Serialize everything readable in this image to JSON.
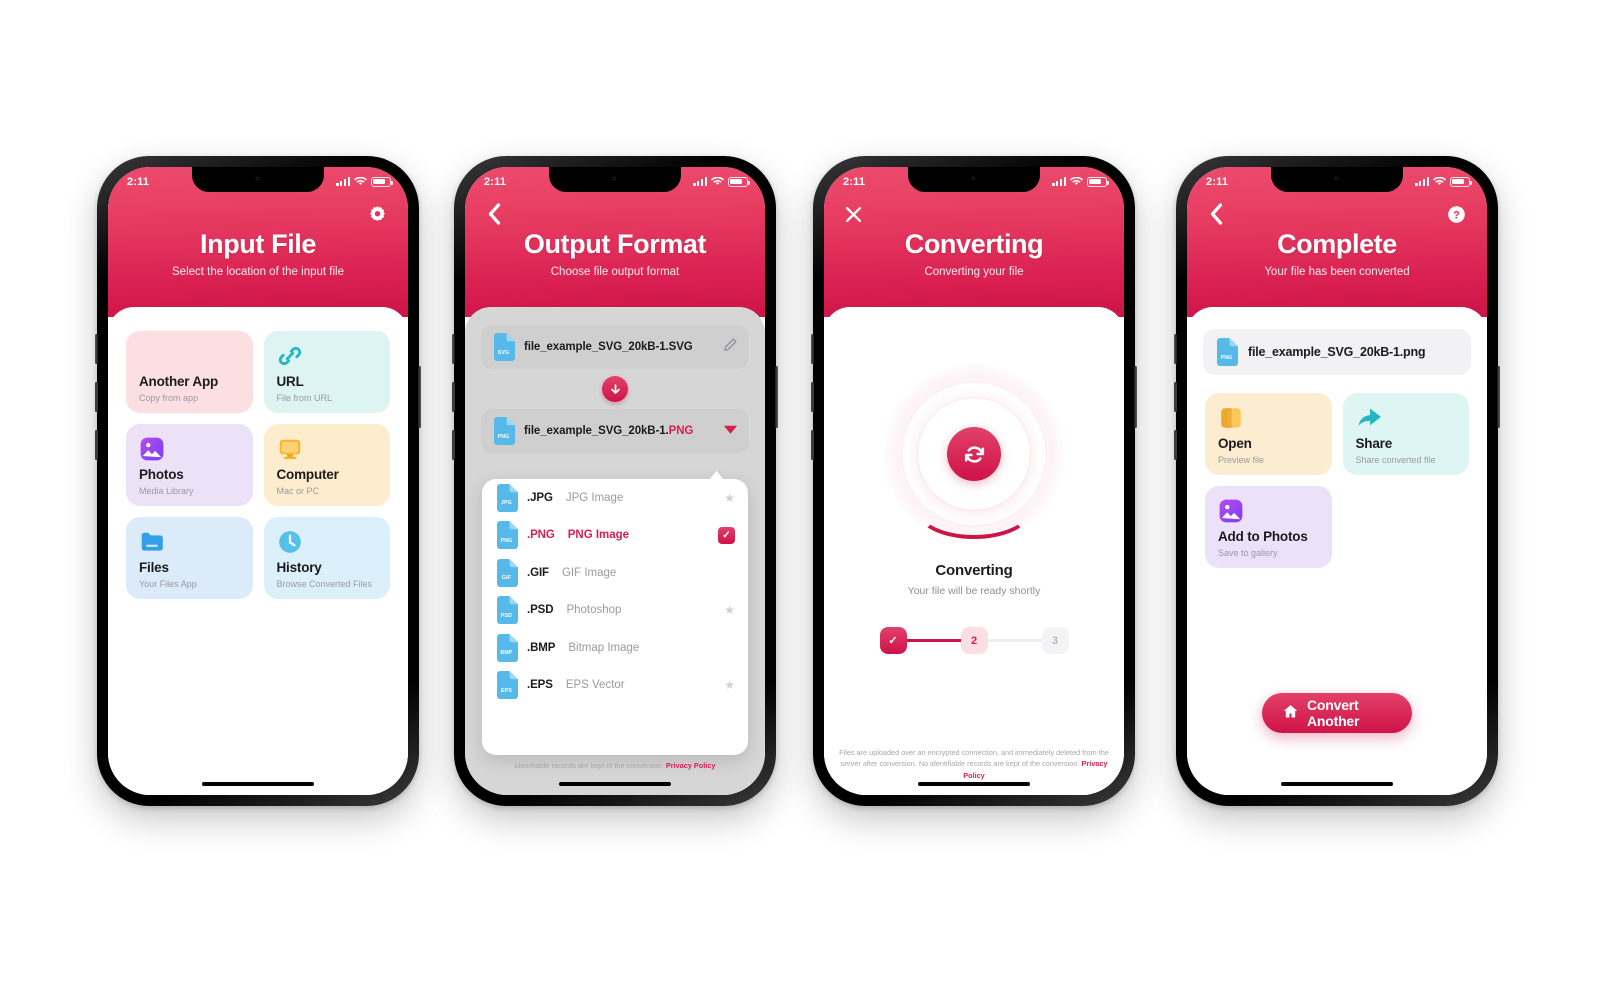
{
  "statusbar": {
    "time": "2:11"
  },
  "brand": {
    "accent": "#d81e50",
    "accent_light": "#ec4b6e",
    "header_gradient_top": "#ec4b6e",
    "header_gradient_bottom": "#cb1447"
  },
  "screens": [
    {
      "id": "input-file",
      "title": "Input File",
      "subtitle": "Select the location of the input file",
      "nav_right_icon": "gear-icon",
      "tiles": [
        {
          "name": "Another App",
          "sub": "Copy from app",
          "icon": "grid-squares-icon",
          "bg": "t-pink"
        },
        {
          "name": "URL",
          "sub": "File from URL",
          "icon": "link-icon",
          "bg": "t-mint"
        },
        {
          "name": "Photos",
          "sub": "Media Library",
          "icon": "photos-icon",
          "bg": "t-lav"
        },
        {
          "name": "Computer",
          "sub": "Mac or PC",
          "icon": "monitor-icon",
          "bg": "t-amber"
        },
        {
          "name": "Files",
          "sub": "Your Files App",
          "icon": "folder-icon",
          "bg": "t-blue"
        },
        {
          "name": "History",
          "sub": "Browse Converted Files",
          "icon": "clock-icon",
          "bg": "t-sky"
        }
      ]
    },
    {
      "id": "output-format",
      "title": "Output Format",
      "subtitle": "Choose file output format",
      "nav_left_icon": "back-chevron-icon",
      "input_file": {
        "badge": "SVG",
        "name": "file_example_SVG_20kB-1.SVG",
        "action_icon": "pencil-icon"
      },
      "output_file": {
        "badge": "PNG",
        "name_base": "file_example_SVG_20kB-1.",
        "name_ext": "PNG",
        "action_icon": "caret-down-icon"
      },
      "formats": [
        {
          "badge": "JPG",
          "ext": ".JPG",
          "desc": "JPG Image",
          "starred": true,
          "selected": false
        },
        {
          "badge": "PNG",
          "ext": ".PNG",
          "desc": "PNG Image",
          "starred": false,
          "selected": true
        },
        {
          "badge": "GIF",
          "ext": ".GIF",
          "desc": "GIF Image",
          "starred": false,
          "selected": false
        },
        {
          "badge": "PSD",
          "ext": ".PSD",
          "desc": "Photoshop",
          "starred": true,
          "selected": false
        },
        {
          "badge": "BMP",
          "ext": ".BMP",
          "desc": "Bitmap Image",
          "starred": false,
          "selected": false
        },
        {
          "badge": "EPS",
          "ext": ".EPS",
          "desc": "EPS Vector",
          "starred": true,
          "selected": false
        }
      ],
      "footnote_clipped": "identifiable records are kept of the conversion.",
      "footnote_link": "Privacy Policy"
    },
    {
      "id": "converting",
      "title": "Converting",
      "subtitle": "Converting your file",
      "nav_left_icon": "close-icon",
      "spinner_icon": "refresh-icon",
      "status_title": "Converting",
      "status_sub": "Your file will be ready shortly",
      "steps": [
        {
          "label": "✓",
          "state": "done"
        },
        {
          "label": "2",
          "state": "cur"
        },
        {
          "label": "3",
          "state": "todo"
        }
      ],
      "footnote": "Files are uploaded over an encrypted connection, and immediately deleted from the server after conversion. No identifiable records are kept of the conversion.",
      "footnote_link": "Privacy Policy"
    },
    {
      "id": "complete",
      "title": "Complete",
      "subtitle": "Your file has been converted",
      "nav_left_icon": "back-chevron-icon",
      "nav_right_icon": "help-icon",
      "result_file": {
        "badge": "PNG",
        "name": "file_example_SVG_20kB-1.png"
      },
      "tiles": [
        {
          "name": "Open",
          "sub": "Preview file",
          "icon": "open-file-icon",
          "bg": "t-amber2"
        },
        {
          "name": "Share",
          "sub": "Share converted file",
          "icon": "share-icon",
          "bg": "t-mint2"
        },
        {
          "name": "Add to Photos",
          "sub": "Save to gallery",
          "icon": "photos-icon",
          "bg": "t-lav2"
        }
      ],
      "cta": {
        "label": "Convert Another",
        "icon": "home-icon"
      }
    }
  ]
}
